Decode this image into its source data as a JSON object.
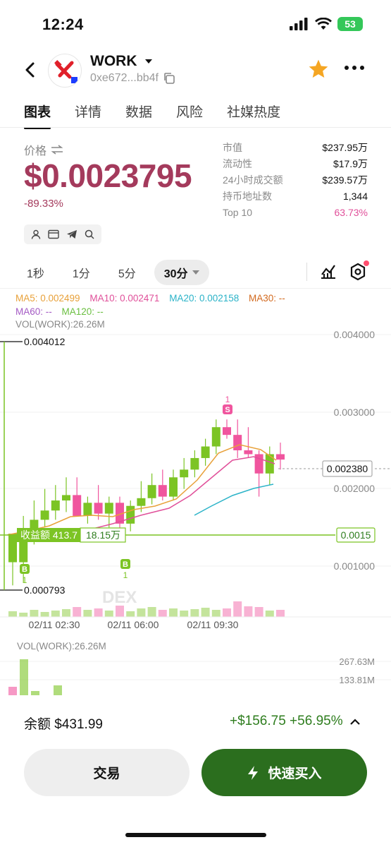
{
  "status_bar": {
    "time": "12:24",
    "battery": "53"
  },
  "header": {
    "token_name": "WORK",
    "address": "0xe672...bb4f"
  },
  "tabs": [
    {
      "label": "图表",
      "active": true
    },
    {
      "label": "详情"
    },
    {
      "label": "数据"
    },
    {
      "label": "风险"
    },
    {
      "label": "社媒热度"
    }
  ],
  "price": {
    "label": "价格",
    "value": "$0.0023795",
    "change": "-89.33%",
    "color": "#a43a5c"
  },
  "stats": [
    {
      "label": "市值",
      "value": "$237.95万"
    },
    {
      "label": "流动性",
      "value": "$17.9万"
    },
    {
      "label": "24小时成交额",
      "value": "$239.57万"
    },
    {
      "label": "持币地址数",
      "value": "1,344"
    },
    {
      "label": "Top 10",
      "value": "63.73%",
      "accent": "#e0509a"
    }
  ],
  "intervals": [
    {
      "label": "1秒"
    },
    {
      "label": "1分"
    },
    {
      "label": "5分"
    },
    {
      "label": "30分",
      "active": true
    }
  ],
  "ma_legend": {
    "ma5": "MA5: 0.002499",
    "ma10": "MA10: 0.002471",
    "ma20": "MA20: 0.002158",
    "ma30": "MA30: --",
    "ma60": "MA60: --",
    "ma120": "MA120: --",
    "vol": "VOL(WORK):26.26M"
  },
  "chart": {
    "y_ticks": [
      "0.004000",
      "0.003000",
      "0.002000",
      "0.001000"
    ],
    "high_marker": "0.004012",
    "low_marker": "0.000793",
    "current_price": "0.002380",
    "entry_price": "0.0015",
    "pnl_tag": "收益额 413.7",
    "pnl_amount": "18.15万",
    "x_ticks": [
      "02/11 02:30",
      "02/11 06:00",
      "02/11 09:30"
    ],
    "watermark": "DEX",
    "buy_mark": "B",
    "sell_mark": "S",
    "mark_count": "1",
    "up_color": "#7cc424",
    "down_color": "#f0559e"
  },
  "chart_data": {
    "type": "candlestick",
    "x_labels": [
      "02/11 02:30",
      "02/11 06:00",
      "02/11 09:30"
    ],
    "ylim": [
      0.0007,
      0.0042
    ],
    "candles": [
      {
        "o": 0.00105,
        "h": 0.00135,
        "l": 0.00075,
        "c": 0.00142,
        "dir": "up"
      },
      {
        "o": 0.00105,
        "h": 0.00165,
        "l": 0.00079,
        "c": 0.00142,
        "dir": "up"
      },
      {
        "o": 0.00142,
        "h": 0.00185,
        "l": 0.00128,
        "c": 0.0016,
        "dir": "up"
      },
      {
        "o": 0.0016,
        "h": 0.002,
        "l": 0.0015,
        "c": 0.00172,
        "dir": "up"
      },
      {
        "o": 0.00172,
        "h": 0.00205,
        "l": 0.0016,
        "c": 0.00185,
        "dir": "up"
      },
      {
        "o": 0.00185,
        "h": 0.00215,
        "l": 0.0017,
        "c": 0.00192,
        "dir": "up"
      },
      {
        "o": 0.00192,
        "h": 0.00215,
        "l": 0.00175,
        "c": 0.00165,
        "dir": "down"
      },
      {
        "o": 0.00165,
        "h": 0.0019,
        "l": 0.00155,
        "c": 0.00182,
        "dir": "up"
      },
      {
        "o": 0.00182,
        "h": 0.00205,
        "l": 0.0016,
        "c": 0.00168,
        "dir": "down"
      },
      {
        "o": 0.00168,
        "h": 0.0019,
        "l": 0.0015,
        "c": 0.00182,
        "dir": "up"
      },
      {
        "o": 0.00182,
        "h": 0.0019,
        "l": 0.00135,
        "c": 0.00155,
        "dir": "down"
      },
      {
        "o": 0.00155,
        "h": 0.00185,
        "l": 0.00145,
        "c": 0.00178,
        "dir": "up"
      },
      {
        "o": 0.00178,
        "h": 0.0021,
        "l": 0.0017,
        "c": 0.00188,
        "dir": "up"
      },
      {
        "o": 0.00188,
        "h": 0.0022,
        "l": 0.0018,
        "c": 0.00205,
        "dir": "up"
      },
      {
        "o": 0.00205,
        "h": 0.00225,
        "l": 0.00185,
        "c": 0.0019,
        "dir": "down"
      },
      {
        "o": 0.0019,
        "h": 0.00225,
        "l": 0.00185,
        "c": 0.00215,
        "dir": "up"
      },
      {
        "o": 0.00215,
        "h": 0.0024,
        "l": 0.002,
        "c": 0.00225,
        "dir": "up"
      },
      {
        "o": 0.00225,
        "h": 0.0025,
        "l": 0.00215,
        "c": 0.0024,
        "dir": "up"
      },
      {
        "o": 0.0024,
        "h": 0.00265,
        "l": 0.0023,
        "c": 0.00255,
        "dir": "up"
      },
      {
        "o": 0.00255,
        "h": 0.0029,
        "l": 0.00245,
        "c": 0.0028,
        "dir": "up"
      },
      {
        "o": 0.0028,
        "h": 0.0029,
        "l": 0.00265,
        "c": 0.0027,
        "dir": "down"
      },
      {
        "o": 0.0027,
        "h": 0.0029,
        "l": 0.0024,
        "c": 0.0025,
        "dir": "down"
      },
      {
        "o": 0.0025,
        "h": 0.0028,
        "l": 0.0024,
        "c": 0.00245,
        "dir": "down"
      },
      {
        "o": 0.00245,
        "h": 0.0025,
        "l": 0.0019,
        "c": 0.0022,
        "dir": "down"
      },
      {
        "o": 0.0022,
        "h": 0.00255,
        "l": 0.00205,
        "c": 0.00245,
        "dir": "up"
      },
      {
        "o": 0.00245,
        "h": 0.0026,
        "l": 0.00225,
        "c": 0.00238,
        "dir": "down"
      }
    ]
  },
  "volume": {
    "label": "VOL(WORK):26.26M",
    "top_label": "267.63M",
    "mid_label": "133.81M"
  },
  "bottom": {
    "balance_label": "余额 $431.99",
    "pnl_label": "+$156.75 +56.95%",
    "trade_button": "交易",
    "quick_buy_button": "快速买入"
  }
}
